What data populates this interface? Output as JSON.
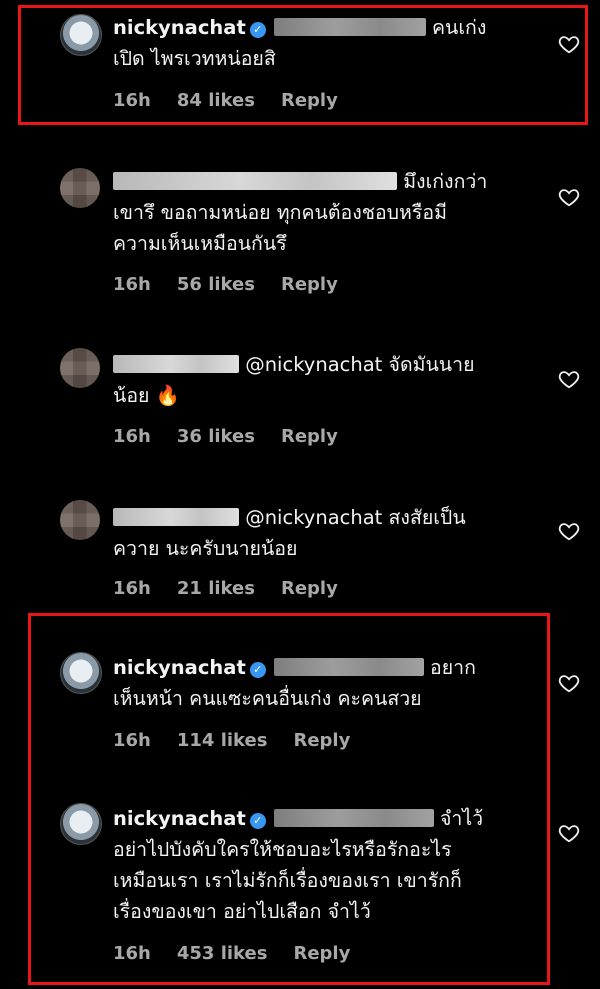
{
  "colors": {
    "background": "#000000",
    "highlight_box": "#e81616",
    "meta_text": "#a8a8a8",
    "verified": "#3897f0"
  },
  "comments": [
    {
      "username": "nickynachat",
      "verified": true,
      "line1": "คนเก่ง",
      "line2": "เปิด ไพรเวทหน่อยสิ",
      "time": "16h",
      "likes": "84 likes",
      "reply": "Reply"
    },
    {
      "line1": "มึงเก่งกว่า",
      "line2": "เขารึ  ขอถามหน่อย  ทุกคนต้องชอบหรือมี",
      "line3": "ความเห็นเหมือนกันรึ",
      "time": "16h",
      "likes": "56 likes",
      "reply": "Reply"
    },
    {
      "line1": "@nickynachat จัดมันนาย",
      "line2": "น้อย 🔥",
      "time": "16h",
      "likes": "36 likes",
      "reply": "Reply"
    },
    {
      "line1": "@nickynachat สงสัยเป็น",
      "line2": "ควาย  นะครับนายน้อย",
      "time": "16h",
      "likes": "21 likes",
      "reply": "Reply"
    },
    {
      "username": "nickynachat",
      "verified": true,
      "line1": "อยาก",
      "line2": "เห็นหน้า คนแซะคนอื่นเก่ง คะคนสวย",
      "time": "16h",
      "likes": "114 likes",
      "reply": "Reply"
    },
    {
      "username": "nickynachat",
      "verified": true,
      "line1": "จำไว้",
      "line2": "อย่าไปบังคับใครให้ชอบอะไรหรือรักอะไร",
      "line3": "เหมือนเรา เราไม่รักก็เรื่องของเรา เขารักก็",
      "line4": "เรื่องของเขา อย่าไปเสือก จำไว้",
      "time": "16h",
      "likes": "453 likes",
      "reply": "Reply"
    }
  ],
  "icons": {
    "like": "heart-outline-icon",
    "verified": "verified-badge-icon"
  }
}
